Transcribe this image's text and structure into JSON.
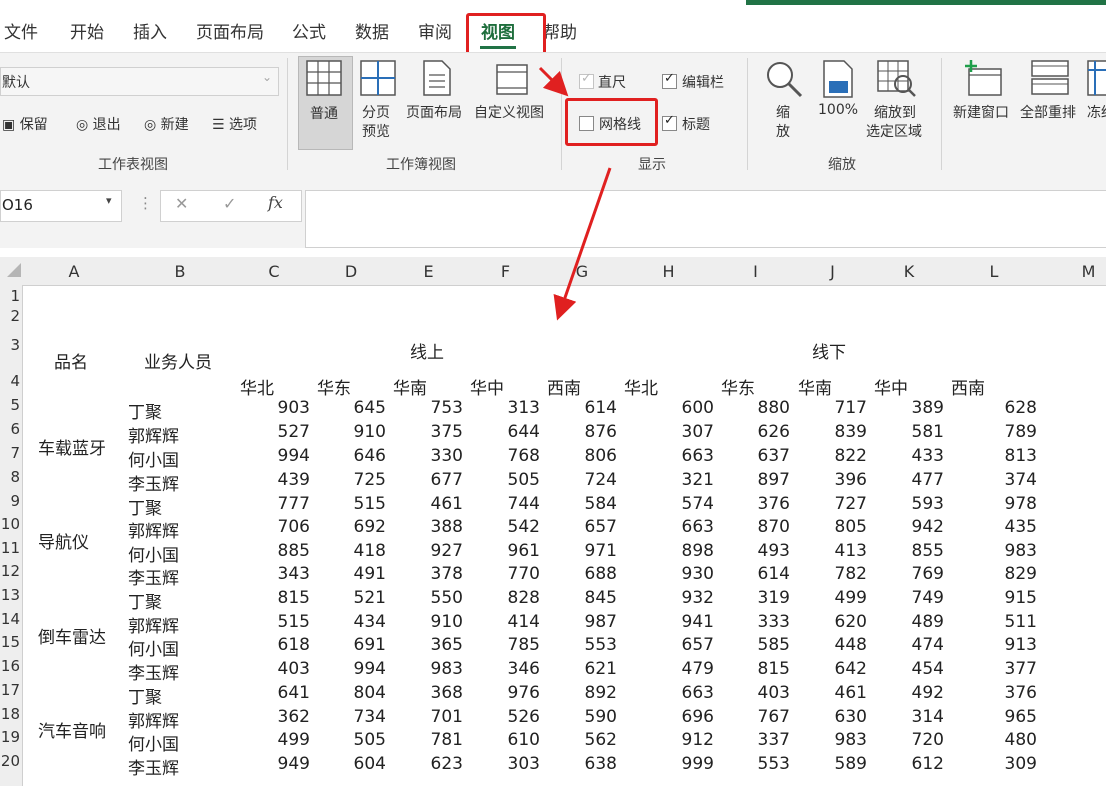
{
  "tabs": [
    {
      "label": "文件"
    },
    {
      "label": "开始"
    },
    {
      "label": "插入"
    },
    {
      "label": "页面布局"
    },
    {
      "label": "公式"
    },
    {
      "label": "数据"
    },
    {
      "label": "审阅"
    },
    {
      "label": "视图"
    },
    {
      "label": "帮助"
    }
  ],
  "ribbon": {
    "sheet_view": {
      "dropdown_value": "默认",
      "keep": "保留",
      "exit": "退出",
      "new": "新建",
      "options": "选项",
      "group_label": "工作表视图"
    },
    "workbook_views": {
      "normal": "普通",
      "page_break_line1": "分页",
      "page_break_line2": "预览",
      "page_layout": "页面布局",
      "custom": "自定义视图",
      "group_label": "工作簿视图"
    },
    "show": {
      "ruler": "直尺",
      "formula_bar": "编辑栏",
      "gridlines": "网格线",
      "headings": "标题",
      "group_label": "显示"
    },
    "zoom": {
      "zoom_line1": "缩",
      "zoom_line2": "放",
      "hundred": "100%",
      "to_sel_line1": "缩放到",
      "to_sel_line2": "选定区域",
      "group_label": "缩放"
    },
    "window": {
      "new_window": "新建窗口",
      "arrange_all": "全部重排",
      "freeze": "冻结"
    }
  },
  "formula_bar": {
    "name_box": "O16",
    "cancel": "✕",
    "enter": "✓",
    "fx": "fx"
  },
  "columns": [
    "A",
    "B",
    "C",
    "D",
    "E",
    "F",
    "G",
    "H",
    "I",
    "J",
    "K",
    "L",
    "M"
  ],
  "rows": [
    "1",
    "2",
    "3",
    "4",
    "5",
    "6",
    "7",
    "8",
    "9",
    "10",
    "11",
    "12",
    "13",
    "14",
    "15",
    "16",
    "17",
    "18",
    "19",
    "20"
  ],
  "sheet": {
    "hdr_product": "品名",
    "hdr_salesperson": "业务人员",
    "online": "线上",
    "offline": "线下",
    "regions": [
      "华北",
      "华东",
      "华南",
      "华中",
      "西南",
      "华北",
      "华东",
      "华南",
      "华中",
      "西南"
    ],
    "products": [
      "车载蓝牙",
      "导航仪",
      "倒车雷达",
      "汽车音响"
    ],
    "people": [
      "丁聚",
      "郭辉辉",
      "何小国",
      "李玉辉"
    ],
    "rows": [
      [
        903,
        645,
        753,
        313,
        614,
        600,
        880,
        717,
        389,
        628
      ],
      [
        527,
        910,
        375,
        644,
        876,
        307,
        626,
        839,
        581,
        789
      ],
      [
        994,
        646,
        330,
        768,
        806,
        663,
        637,
        822,
        433,
        813
      ],
      [
        439,
        725,
        677,
        505,
        724,
        321,
        897,
        396,
        477,
        374
      ],
      [
        777,
        515,
        461,
        744,
        584,
        574,
        376,
        727,
        593,
        978
      ],
      [
        706,
        692,
        388,
        542,
        657,
        663,
        870,
        805,
        942,
        435
      ],
      [
        885,
        418,
        927,
        961,
        971,
        898,
        493,
        413,
        855,
        983
      ],
      [
        343,
        491,
        378,
        770,
        688,
        930,
        614,
        782,
        769,
        829
      ],
      [
        815,
        521,
        550,
        828,
        845,
        932,
        319,
        499,
        749,
        915
      ],
      [
        515,
        434,
        910,
        414,
        987,
        941,
        333,
        620,
        489,
        511
      ],
      [
        618,
        691,
        365,
        785,
        553,
        657,
        585,
        448,
        474,
        913
      ],
      [
        403,
        994,
        983,
        346,
        621,
        479,
        815,
        642,
        454,
        377
      ],
      [
        641,
        804,
        368,
        976,
        892,
        663,
        403,
        461,
        492,
        376
      ],
      [
        362,
        734,
        701,
        526,
        590,
        696,
        767,
        630,
        314,
        965
      ],
      [
        499,
        505,
        781,
        610,
        562,
        912,
        337,
        983,
        720,
        480
      ],
      [
        949,
        604,
        623,
        303,
        638,
        999,
        553,
        589,
        612,
        309
      ]
    ]
  },
  "colors": {
    "accent": "#217346",
    "highlight": "#e02020"
  }
}
